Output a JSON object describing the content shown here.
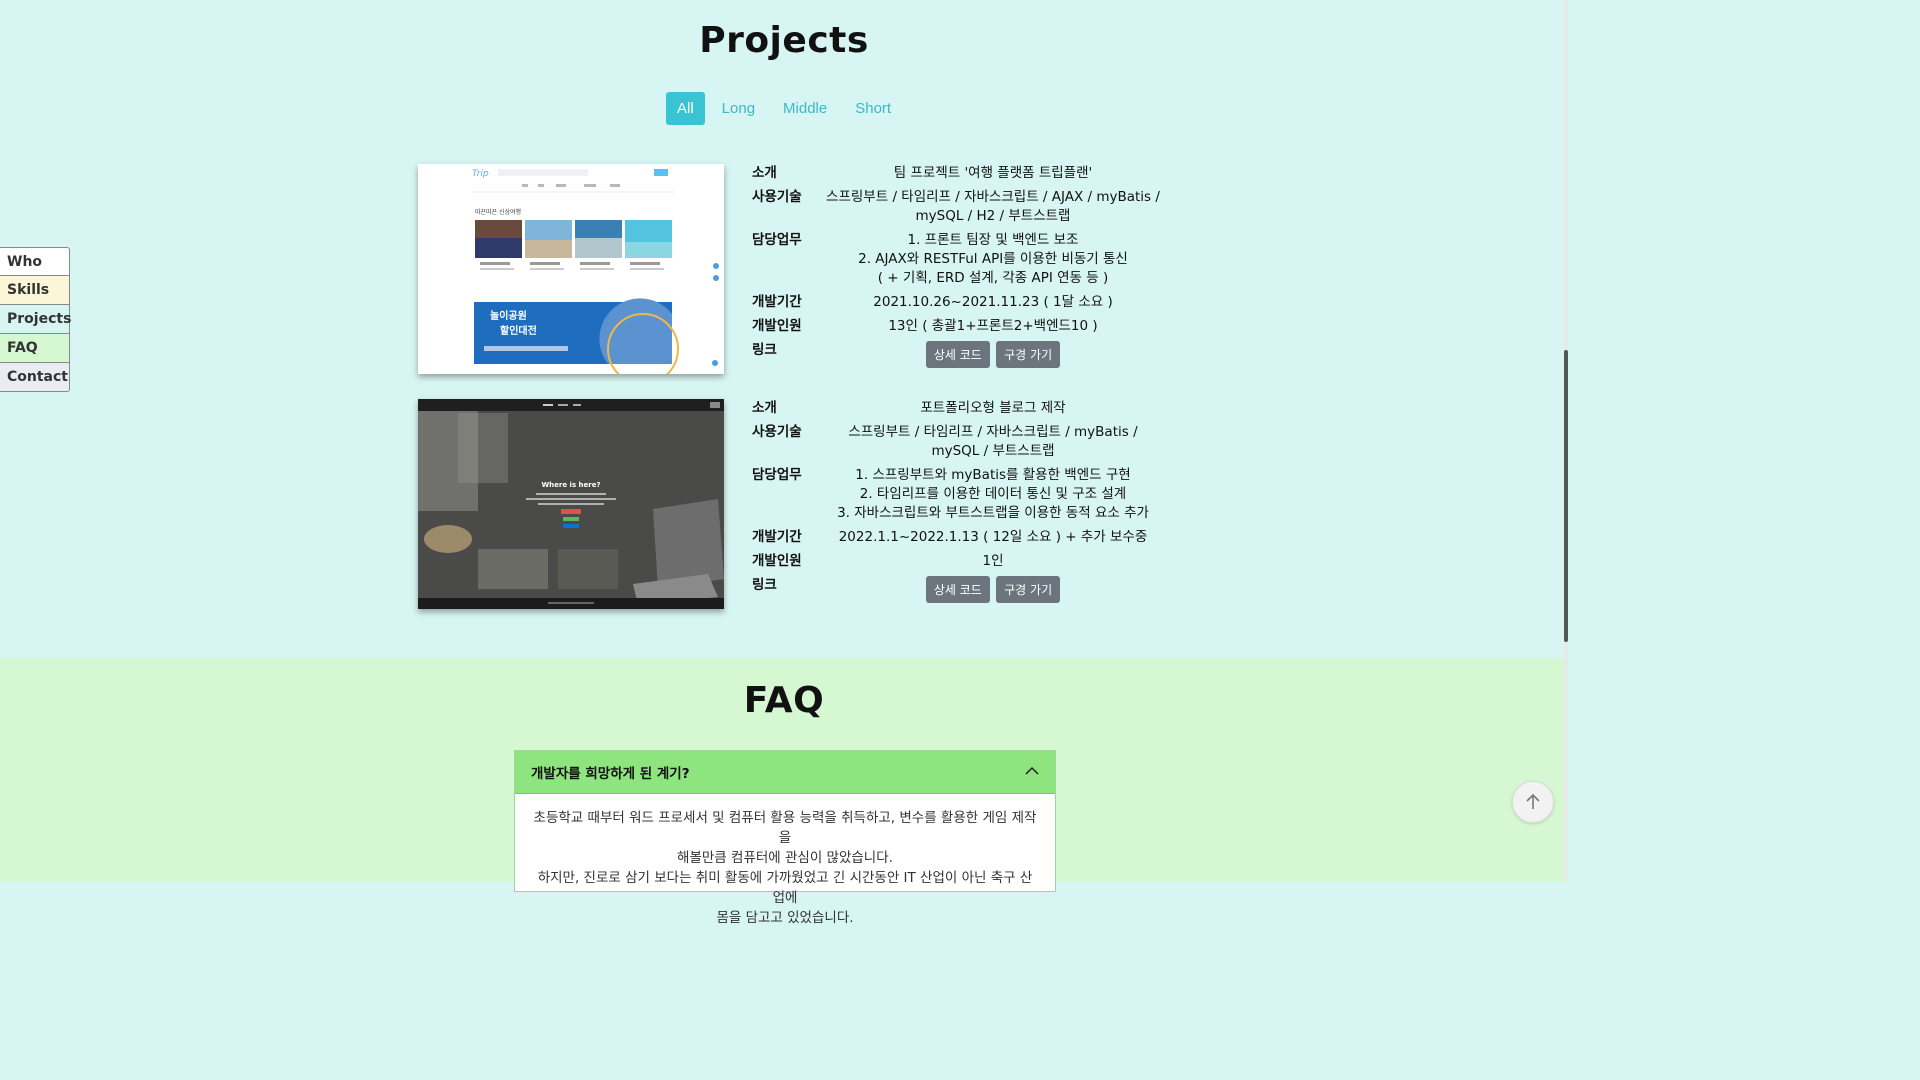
{
  "projects": {
    "title": "Projects",
    "filters": [
      {
        "label": "All",
        "active": true
      },
      {
        "label": "Long",
        "active": false
      },
      {
        "label": "Middle",
        "active": false
      },
      {
        "label": "Short",
        "active": false
      }
    ],
    "items": [
      {
        "intro_label": "소개",
        "intro": "팀 프로젝트 '여행 플랫폼 트립플랜'",
        "tech_label": "사용기술",
        "tech_line1": "스프링부트 / 타임리프 / 자바스크립트 / AJAX / myBatis /",
        "tech_line2": "mySQL / H2 / 부트스트랩",
        "role_label": "담당업무",
        "role_lines": [
          "1. 프론트 팀장 및 백엔드 보조",
          "2. AJAX와 RESTFul API를 이용한 비동기 통신",
          "( + 기획, ERD 설계, 각종 API 연동 등 )"
        ],
        "period_label": "개발기간",
        "period": "2021.10.26~2021.11.23 ( 1달 소요 )",
        "members_label": "개발인원",
        "members": "13인 ( 총괄1+프론트2+백엔드10 )",
        "link_label": "링크",
        "code_button": "상세 코드",
        "visit_button": "구경 가기",
        "thumb_banner_line1": "놀이공원",
        "thumb_banner_line2": "할인대전",
        "thumb_section": "따끈따끈 신상여행"
      },
      {
        "intro_label": "소개",
        "intro": "포트폴리오형 블로그 제작",
        "tech_label": "사용기술",
        "tech_line1": "스프링부트 / 타임리프 / 자바스크립트 / myBatis /",
        "tech_line2": "mySQL / 부트스트랩",
        "role_label": "담당업무",
        "role_lines": [
          "1. 스프링부트와 myBatis를 활용한 백엔드 구현",
          "2. 타임리프를 이용한 데이터 통신 및 구조 설계",
          "3. 자바스크립트와 부트스트랩을 이용한 동적 요소 추가"
        ],
        "period_label": "개발기간",
        "period": "2022.1.1~2022.1.13 ( 12일 소요 ) + 추가 보수중",
        "members_label": "개발인원",
        "members": "1인",
        "link_label": "링크",
        "code_button": "상세 코드",
        "visit_button": "구경 가기",
        "thumb_heading": "Where is here?"
      }
    ]
  },
  "side_nav": [
    "Who",
    "Skills",
    "Projects",
    "FAQ",
    "Contact"
  ],
  "faq": {
    "title": "FAQ",
    "question": "개발자를 희망하게 된 계기?",
    "answer_lines": [
      "초등학교 때부터 워드 프로세서 및 컴퓨터 활용 능력을 취득하고, 변수를 활용한 게임 제작을",
      "해볼만큼 컴퓨터에 관심이 많았습니다.",
      "하지만, 진로로 삼기 보다는 취미 활동에 가까웠었고 긴 시간동안 IT 산업이 아닌 축구 산업에",
      "몸을 담고고 있었습니다."
    ]
  },
  "colors": {
    "accent": "#3ac3d2",
    "projects_bg": "#d7f5f2",
    "faq_bg": "#d5f7d2",
    "faq_head": "#8ee47e"
  }
}
